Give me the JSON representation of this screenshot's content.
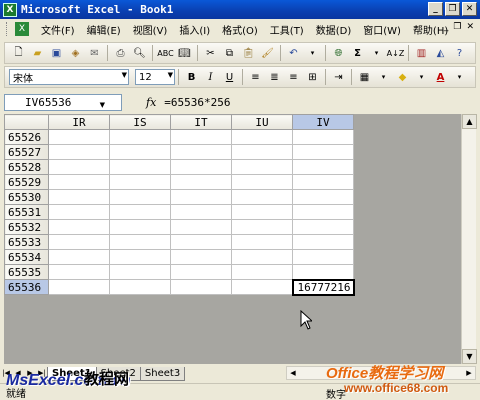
{
  "window": {
    "title": "Microsoft Excel - Book1"
  },
  "menu": [
    "文件(F)",
    "编辑(E)",
    "视图(V)",
    "插入(I)",
    "格式(O)",
    "工具(T)",
    "数据(D)",
    "窗口(W)",
    "帮助(H)"
  ],
  "format_toolbar": {
    "font": "宋体",
    "size": "12",
    "bold": "B",
    "italic": "I",
    "underline": "U"
  },
  "formula_bar": {
    "name_box": "IV65536",
    "fx": "fx",
    "formula": "=65536*256"
  },
  "columns": [
    "IR",
    "IS",
    "IT",
    "IU",
    "IV"
  ],
  "rows": [
    "65526",
    "65527",
    "65528",
    "65529",
    "65530",
    "65531",
    "65532",
    "65533",
    "65534",
    "65535",
    "65536"
  ],
  "active_cell": {
    "row": "65536",
    "col": "IV",
    "value": "16777216"
  },
  "sheet_tabs": [
    "Sheet1",
    "Sheet2",
    "Sheet3"
  ],
  "status": {
    "left": "就绪",
    "right": "数字"
  },
  "watermark": {
    "left_logo": "MsExcel.com.cn",
    "left_cn": "教程网",
    "right_title": "Office教程学习网",
    "right_url": "www.office68.com"
  }
}
